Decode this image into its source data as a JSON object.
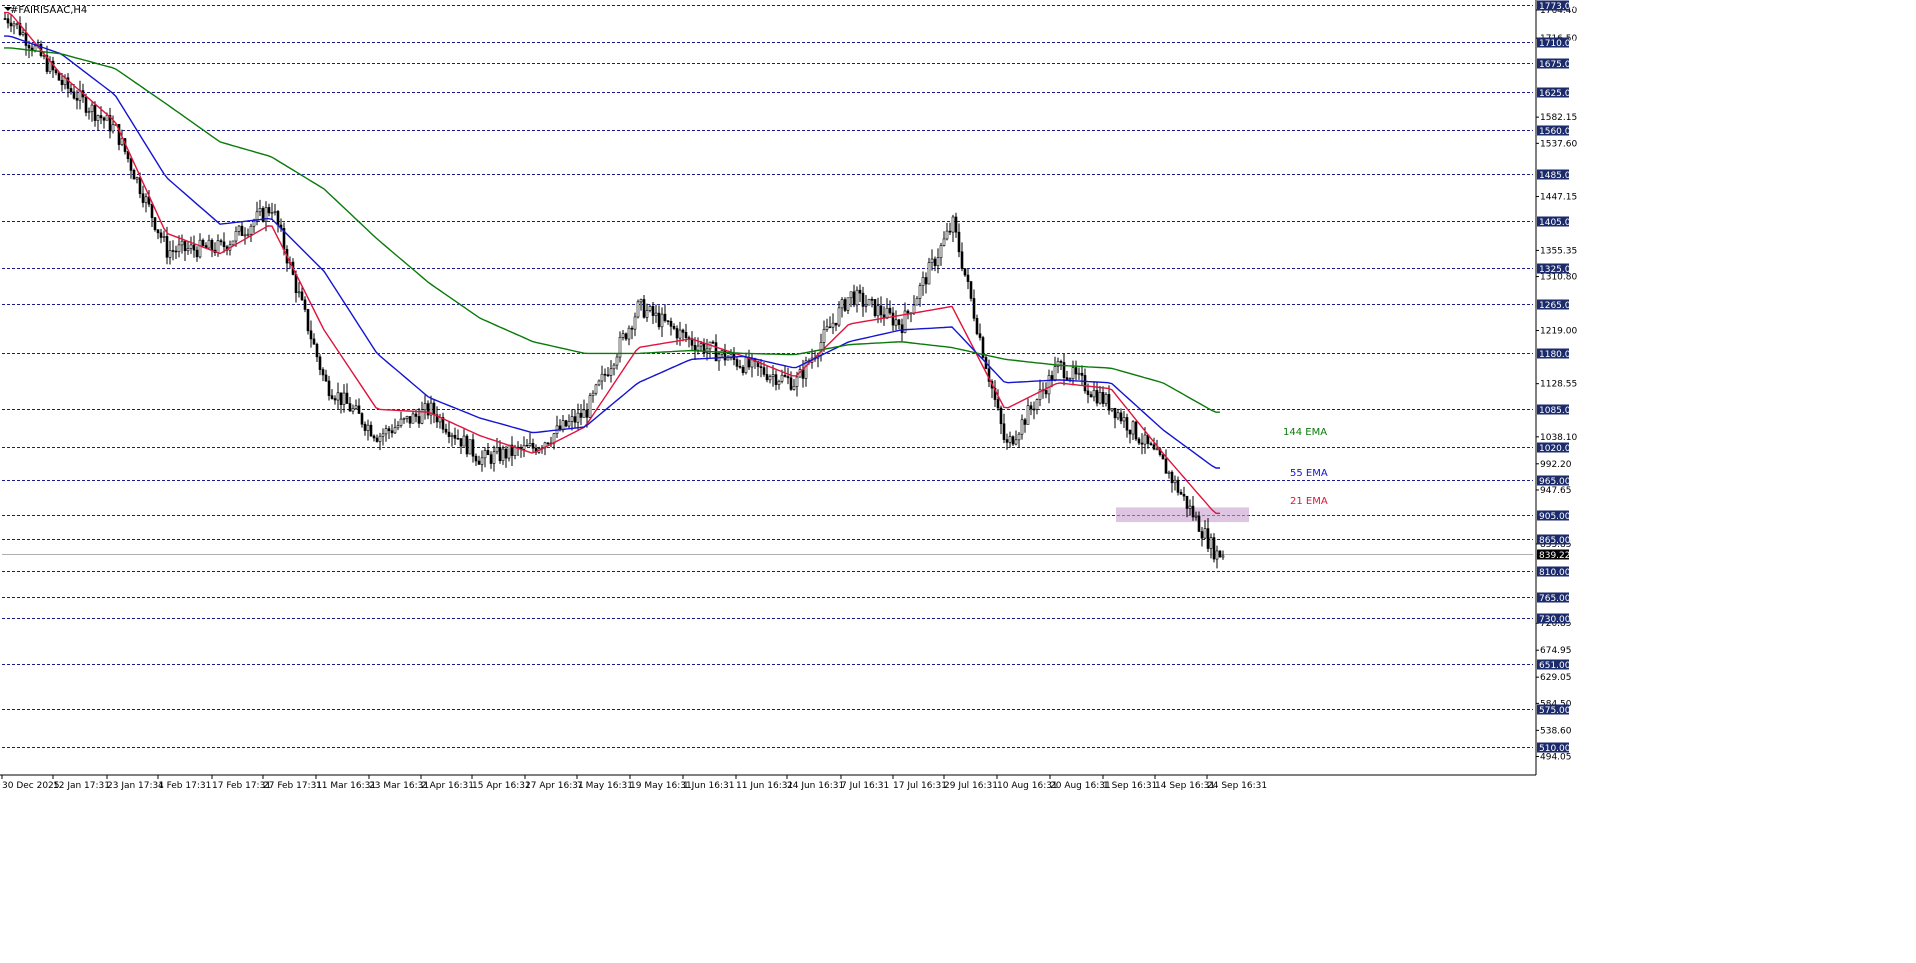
{
  "symbol_title": "#FAIRISAAC,H4",
  "colors": {
    "background": "#ffffff",
    "grid": "#1a1a8c",
    "bull_candle": "#000000",
    "bear_candle": "#000000",
    "ema_21": "#e0143c",
    "ema_55": "#1414d2",
    "ema_144": "#0a7a0a",
    "level_tag": "#1b2a6b",
    "zone_fill": "#c8a0d0"
  },
  "axis": {
    "price_ticks": [
      "1764.40",
      "1716.50",
      "1582.15",
      "1537.60",
      "1447.15",
      "1355.35",
      "1310.80",
      "1219.00",
      "1128.55",
      "1038.10",
      "992.20",
      "947.65",
      "855.85",
      "720.85",
      "674.95",
      "629.05",
      "584.50",
      "538.60",
      "494.05"
    ],
    "date_ticks": [
      "30 Dec 2025",
      "12 Jan 17:31",
      "23 Jan 17:31",
      "4 Feb 17:31",
      "17 Feb 17:31",
      "27 Feb 17:31",
      "11 Mar 16:31",
      "23 Mar 16:31",
      "2 Apr 16:31",
      "15 Apr 16:31",
      "27 Apr 16:31",
      "7 May 16:31",
      "19 May 16:31",
      "1 Jun 16:31",
      "11 Jun 16:31",
      "24 Jun 16:31",
      "7 Jul 16:31",
      "17 Jul 16:31",
      "29 Jul 16:31",
      "10 Aug 16:31",
      "20 Aug 16:31",
      "1 Sep 16:31",
      "14 Sep 16:31",
      "24 Sep 16:31"
    ]
  },
  "levels": [
    "1773.00",
    "1710.00",
    "1675.00",
    "1625.00",
    "1560.00",
    "1485.00",
    "1405.00",
    "1325.00",
    "1265.00",
    "1180.00",
    "1085.00",
    "1020.00",
    "965.00",
    "905.00",
    "865.00",
    "810.00",
    "765.00",
    "730.00",
    "651.00",
    "575.00",
    "510.00"
  ],
  "current_price": "839.22",
  "ema_labels": [
    {
      "text": "144  EMA",
      "color": "#0a7a0a"
    },
    {
      "text": "55  EMA",
      "color": "#1414d2"
    },
    {
      "text": "21  EMA",
      "color": "#e0143c"
    }
  ],
  "chart_data": {
    "type": "line",
    "title": "#FAIRISAAC,H4",
    "ylim": [
      494.05,
      1773.0
    ],
    "x": [
      "30 Dec 2025",
      "12 Jan 17:31",
      "23 Jan 17:31",
      "4 Feb 17:31",
      "17 Feb 17:31",
      "27 Feb 17:31",
      "11 Mar 16:31",
      "23 Mar 16:31",
      "2 Apr 16:31",
      "15 Apr 16:31",
      "27 Apr 16:31",
      "7 May 16:31",
      "19 May 16:31",
      "1 Jun 16:31",
      "11 Jun 16:31",
      "24 Jun 16:31",
      "7 Jul 16:31",
      "17 Jul 16:31",
      "29 Jul 16:31",
      "10 Aug 16:31",
      "20 Aug 16:31",
      "1 Sep 16:31",
      "14 Sep 16:31",
      "24 Sep 16:31"
    ],
    "price_close": [
      1750,
      1640,
      1560,
      1355,
      1360,
      1430,
      1130,
      1040,
      1085,
      1000,
      1020,
      1080,
      1260,
      1200,
      1160,
      1130,
      1280,
      1230,
      1400,
      1020,
      1160,
      1090,
      990,
      839.22
    ],
    "series": [
      {
        "name": "21  EMA",
        "values": [
          1760,
          1655,
          1575,
          1385,
          1350,
          1400,
          1220,
          1085,
          1080,
          1040,
          1010,
          1055,
          1190,
          1205,
          1175,
          1140,
          1230,
          1245,
          1260,
          1085,
          1130,
          1120,
          1010,
          908
        ]
      },
      {
        "name": "55  EMA",
        "values": [
          1720,
          1690,
          1620,
          1480,
          1400,
          1410,
          1320,
          1180,
          1105,
          1070,
          1045,
          1055,
          1130,
          1170,
          1175,
          1155,
          1200,
          1220,
          1225,
          1130,
          1135,
          1130,
          1050,
          985
        ]
      },
      {
        "name": "144  EMA",
        "values": [
          1700,
          1690,
          1665,
          1605,
          1540,
          1515,
          1460,
          1375,
          1300,
          1240,
          1200,
          1180,
          1180,
          1185,
          1180,
          1178,
          1195,
          1200,
          1190,
          1170,
          1160,
          1155,
          1130,
          1080
        ]
      }
    ],
    "levels": [
      1773,
      1710,
      1675,
      1625,
      1560,
      1485,
      1405,
      1325,
      1265,
      1180,
      1085,
      1020,
      965,
      905,
      865,
      810,
      765,
      730,
      651,
      575,
      510
    ],
    "zone": [
      893,
      918
    ],
    "grid": false,
    "legend": "right"
  }
}
